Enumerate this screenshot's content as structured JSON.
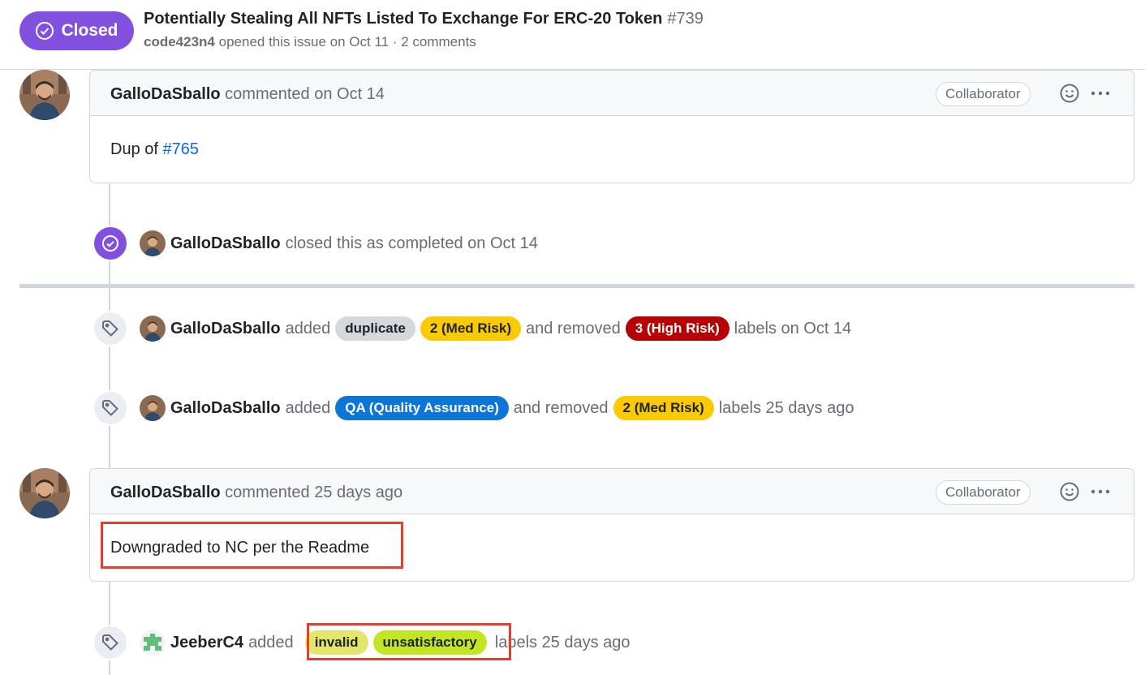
{
  "header": {
    "state": "Closed",
    "title": "Potentially Stealing All NFTs Listed To Exchange For ERC-20 Token",
    "number": "#739",
    "author": "code423n4",
    "meta": "opened this issue on Oct 11 · 2 comments"
  },
  "comments": [
    {
      "author": "GalloDaSballo",
      "action": "commented on Oct 14",
      "badge": "Collaborator",
      "body_prefix": "Dup of ",
      "body_link": "#765"
    },
    {
      "author": "GalloDaSballo",
      "action": "commented 25 days ago",
      "badge": "Collaborator",
      "body": "Downgraded to NC per the Readme"
    }
  ],
  "events": {
    "closed": {
      "author": "GalloDaSballo",
      "text": "closed this as completed on Oct 14"
    },
    "label1": {
      "author": "GalloDaSballo",
      "added": "added",
      "labels_added": [
        {
          "name": "duplicate",
          "bg": "#d4d7db",
          "fg": "#1f2328"
        },
        {
          "name": "2 (Med Risk)",
          "bg": "#fbca04",
          "fg": "#1f2328"
        }
      ],
      "removed": "and removed",
      "labels_removed": [
        {
          "name": "3 (High Risk)",
          "bg": "#b60205",
          "fg": "#ffffff"
        }
      ],
      "suffix": "labels on Oct 14"
    },
    "label2": {
      "author": "GalloDaSballo",
      "added": "added",
      "labels_added": [
        {
          "name": "QA (Quality Assurance)",
          "bg": "#0e75d8",
          "fg": "#ffffff"
        }
      ],
      "removed": "and removed",
      "labels_removed": [
        {
          "name": "2 (Med Risk)",
          "bg": "#fbca04",
          "fg": "#1f2328"
        }
      ],
      "suffix": "labels 25 days ago"
    },
    "label3": {
      "author": "JeeberC4",
      "added": "added",
      "labels_added": [
        {
          "name": "invalid",
          "bg": "#e4e669",
          "fg": "#1f2328"
        },
        {
          "name": "unsatisfactory",
          "bg": "#c2e623",
          "fg": "#1f2328"
        }
      ],
      "suffix": "labels 25 days ago"
    }
  },
  "colors": {
    "closed_purple": "#8250df",
    "link_blue": "#0969da",
    "highlight_red": "#e5402f"
  },
  "icons": [
    "check-circle-icon",
    "tag-icon",
    "smiley-icon",
    "kebab-icon"
  ]
}
